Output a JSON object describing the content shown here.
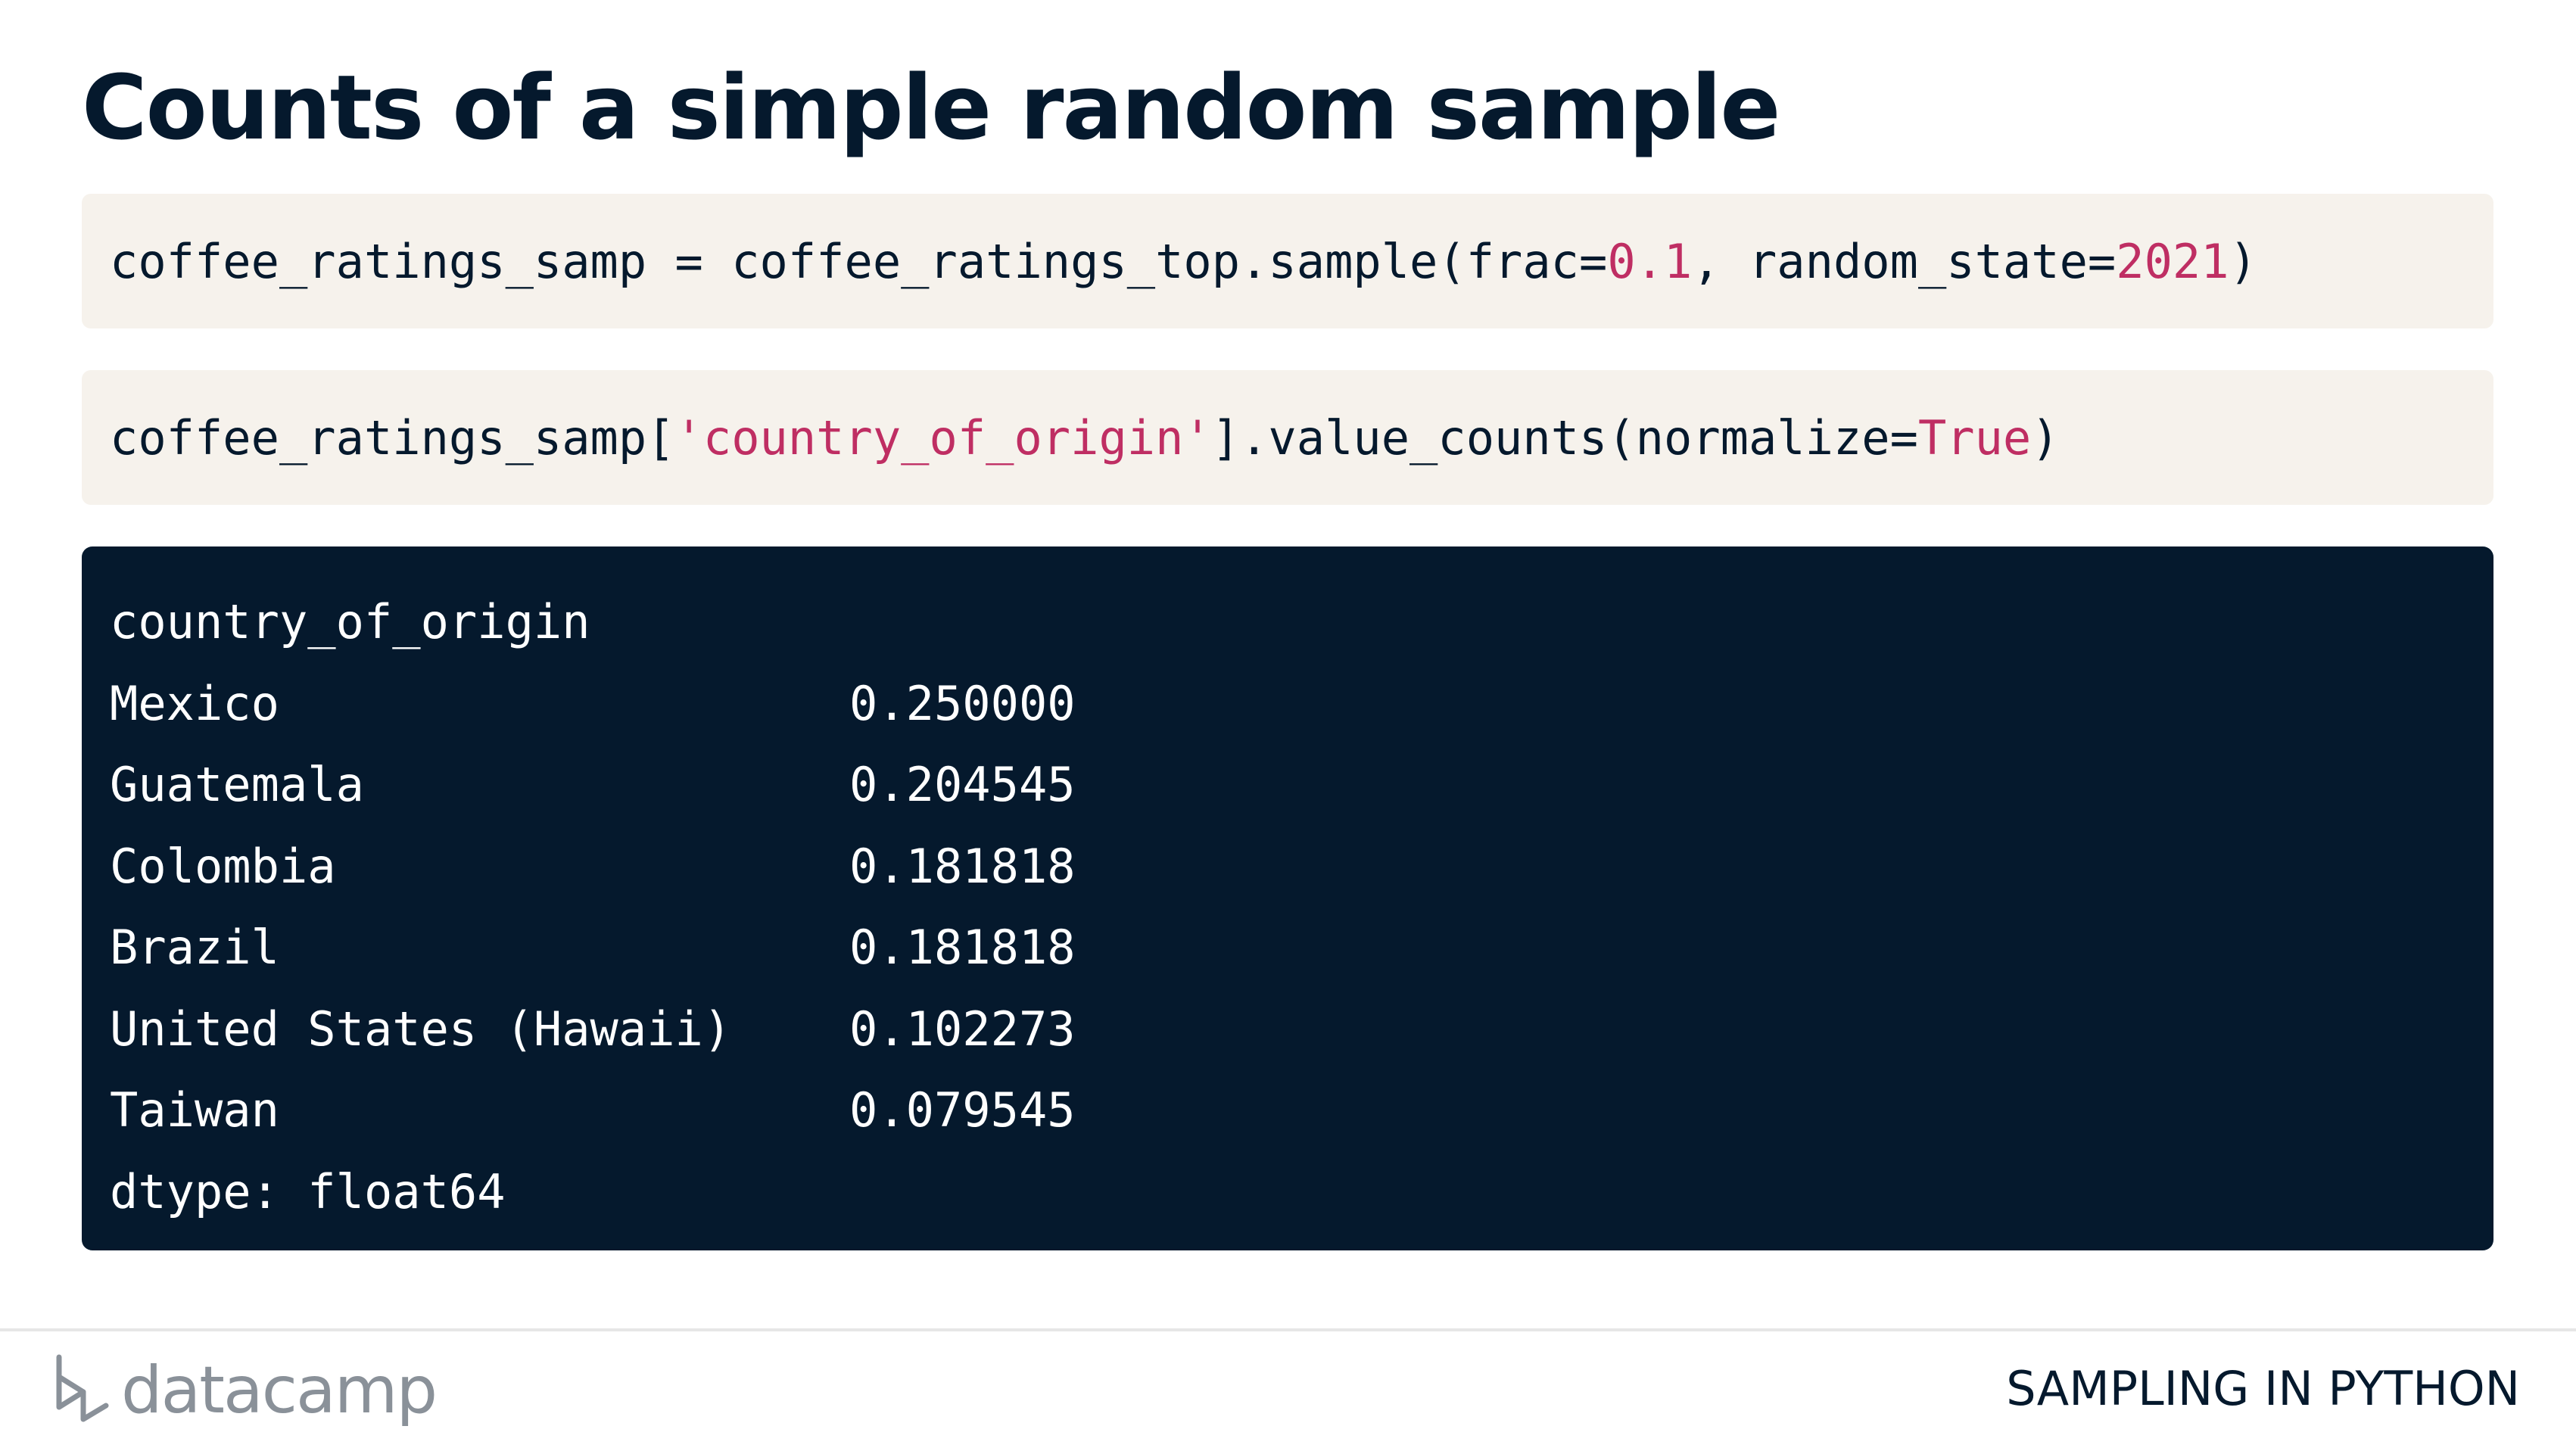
{
  "title": "Counts of a simple random sample",
  "code_1": {
    "prefix": "coffee_ratings_samp = coffee_ratings_top.sample(frac=",
    "frac_value": "0.1",
    "middle": ", random_state=",
    "random_state_value": "2021",
    "suffix": ")"
  },
  "code_2": {
    "prefix": "coffee_ratings_samp[",
    "column_string": "'country_of_origin'",
    "middle": "].value_counts(normalize=",
    "normalize_value": "True",
    "suffix": ")"
  },
  "output": {
    "header": "country_of_origin",
    "rows": [
      {
        "country": "Mexico",
        "value": "0.250000"
      },
      {
        "country": "Guatemala",
        "value": "0.204545"
      },
      {
        "country": "Colombia",
        "value": "0.181818"
      },
      {
        "country": "Brazil",
        "value": "0.181818"
      },
      {
        "country": "United States (Hawaii)",
        "value": "0.102273"
      },
      {
        "country": "Taiwan",
        "value": "0.079545"
      }
    ],
    "dtype": "dtype: float64"
  },
  "footer": {
    "logo_text": "datacamp",
    "course_name": "SAMPLING IN PYTHON"
  },
  "colors": {
    "navy": "#05192d",
    "code_bg": "#f6f2ec",
    "literal": "#bf2e63",
    "logo_gray": "#8a9199"
  }
}
